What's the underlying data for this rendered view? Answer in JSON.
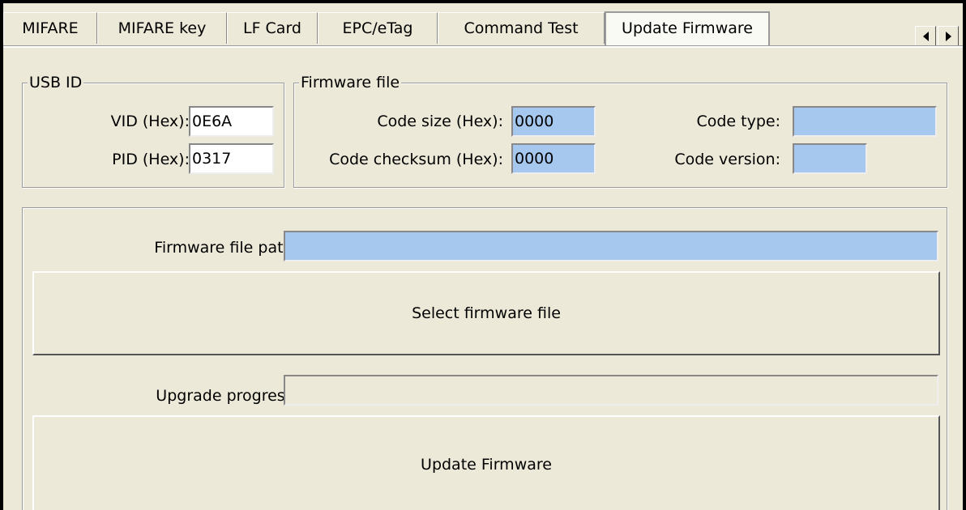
{
  "tabs": [
    "MIFARE",
    "MIFARE key",
    "LF Card",
    "EPC/eTag",
    "Command Test",
    "Update Firmware"
  ],
  "active_tab": "Update Firmware",
  "usb_id": {
    "legend": "USB ID",
    "vid_label": "VID (Hex):",
    "vid_value": "0E6A",
    "pid_label": "PID (Hex):",
    "pid_value": "0317"
  },
  "firmware_file": {
    "legend": "Firmware file",
    "code_size_label": "Code size (Hex):",
    "code_size_value": "0000",
    "code_checksum_label": "Code checksum (Hex):",
    "code_checksum_value": "0000",
    "code_type_label": "Code type:",
    "code_type_value": "",
    "code_version_label": "Code version:",
    "code_version_value": ""
  },
  "update": {
    "path_label": "Firmware file path:",
    "path_value": "",
    "select_button": "Select firmware file",
    "progress_label": "Upgrade progress:",
    "progress_value": "",
    "update_button": "Update Firmware"
  },
  "colors": {
    "window_bg": "#ece9d8",
    "readonly_field": "#a6c8ef"
  },
  "icons": {
    "scroll_left": "triangle-left",
    "scroll_right": "triangle-right"
  }
}
